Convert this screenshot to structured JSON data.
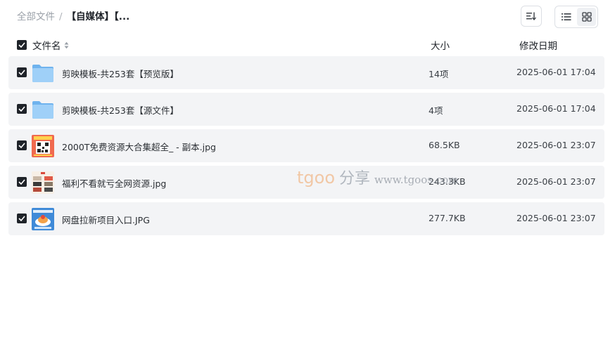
{
  "breadcrumb": {
    "root": "全部文件",
    "separator": "/",
    "current": "【自媒体】【..."
  },
  "toolbar": {
    "sort_icon": "sort-list-icon",
    "view_list_icon": "list-view-icon",
    "view_grid_icon": "grid-view-icon"
  },
  "table": {
    "headers": {
      "name": "文件名",
      "size": "大小",
      "date": "修改日期"
    },
    "rows": [
      {
        "name": "剪映模板-共253套【预览版】",
        "size": "14项",
        "date": "2025-06-01 17:04",
        "type": "folder",
        "checked": true
      },
      {
        "name": "剪映模板-共253套【源文件】",
        "size": "4项",
        "date": "2025-06-01 17:04",
        "type": "folder",
        "checked": true
      },
      {
        "name": "2000T免费资源大合集超全_ - 副本.jpg",
        "size": "68.5KB",
        "date": "2025-06-01 23:07",
        "type": "image",
        "checked": true
      },
      {
        "name": "福利不看就亏全网资源.jpg",
        "size": "243.3KB",
        "date": "2025-06-01 23:07",
        "type": "image",
        "checked": true
      },
      {
        "name": "网盘拉新项目入口.JPG",
        "size": "277.7KB",
        "date": "2025-06-01 23:07",
        "type": "image",
        "checked": true
      }
    ]
  },
  "watermark": {
    "logo": "tgoo",
    "share": "分享",
    "site": "www.tgoos.com"
  },
  "colors": {
    "row_bg": "#f3f4f6",
    "check": "#1f2329",
    "folder": "#8cc4f5",
    "accent": "#f1b98a"
  }
}
